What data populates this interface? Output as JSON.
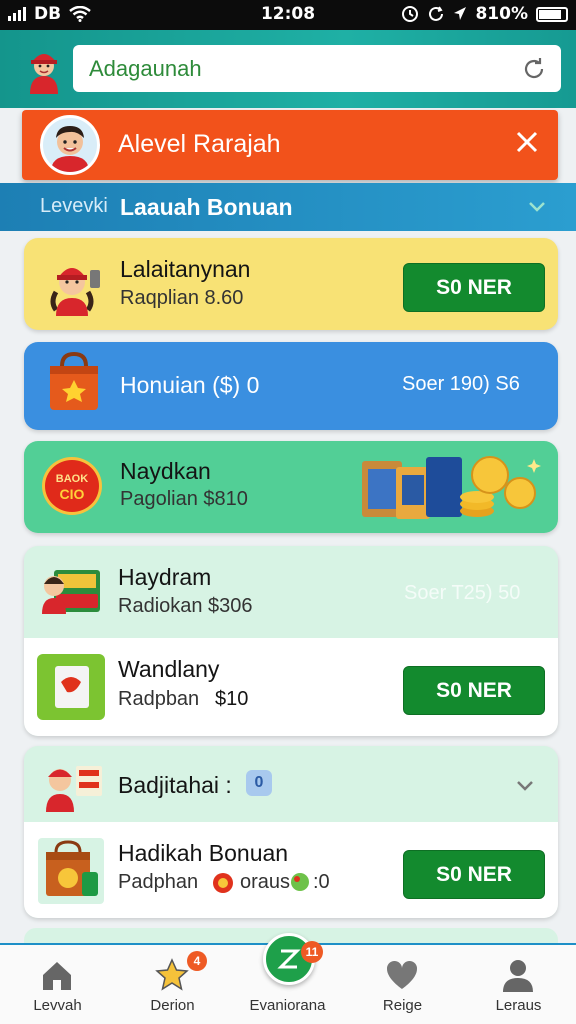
{
  "status_bar": {
    "left": "DB",
    "time": "12:08",
    "battery": "810%"
  },
  "search": {
    "value": "Adagaunah"
  },
  "banner": {
    "title": "Alevel Rarajah"
  },
  "level": {
    "prefix": "Levevki",
    "title": "Laauah Bonuan"
  },
  "cards": [
    {
      "title": "Lalaitanynan",
      "subtitle": "Raqplian 8.60",
      "button": "S0 NER"
    },
    {
      "title": "Honuian ($) 0",
      "amount": "Soer 190) S6"
    },
    {
      "title": "Naydkan",
      "subtitle": "Pagolian $810",
      "logo_text": "BAOK",
      "logo_sub": "CIO"
    },
    {
      "title": "Haydram",
      "subtitle": "Radiokan $306",
      "amount": "Soer T25) 50"
    },
    {
      "title": "Wandlany",
      "subtitle": "Radpban",
      "price": "$10",
      "button": "S0 NER"
    },
    {
      "title": "Badjitahai :",
      "badge": "0"
    },
    {
      "title": "Hadikah Bonuan",
      "subtitle_a": "Padphan",
      "subtitle_b": "oraus",
      "subtitle_c": ":0",
      "button": "S0 NER"
    }
  ],
  "bottom_nav": [
    {
      "label": "Levvah"
    },
    {
      "label": "Derion",
      "badge": "4"
    },
    {
      "label": "Evaniorana",
      "badge": "11"
    },
    {
      "label": "Reige"
    },
    {
      "label": "Leraus"
    }
  ],
  "colors": {
    "accent": "#138a2e",
    "banner": "#f2521b",
    "header": "#1fb0a5",
    "levelbar": "#1d7fb4"
  }
}
